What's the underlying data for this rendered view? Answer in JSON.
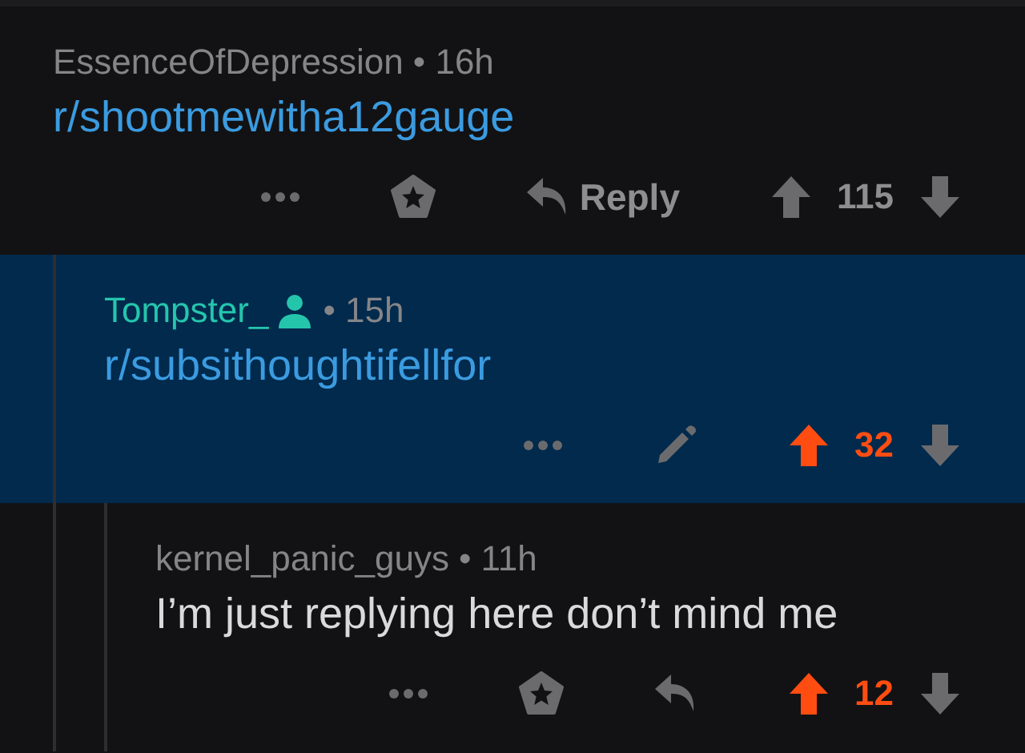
{
  "comments": [
    {
      "author": "EssenceOfDepression",
      "own": false,
      "time": "• 16h",
      "body": "r/shootmewitha12gauge",
      "link": true,
      "highlighted": false,
      "actions": [
        {
          "kind": "more"
        },
        {
          "kind": "award"
        },
        {
          "kind": "reply",
          "label": "Reply"
        }
      ],
      "score": "115",
      "upvoted": false,
      "children": [
        {
          "author": "Tompster_",
          "own": true,
          "time": "• 15h",
          "body": "r/subsithoughtifellfor",
          "link": true,
          "highlighted": true,
          "actions": [
            {
              "kind": "more"
            },
            {
              "kind": "edit"
            }
          ],
          "score": "32",
          "upvoted": true,
          "children": [
            {
              "author": "kernel_panic_guys",
              "own": false,
              "time": "• 11h",
              "body": "I’m just replying here don’t mind me",
              "link": false,
              "highlighted": false,
              "actions": [
                {
                  "kind": "more"
                },
                {
                  "kind": "award"
                },
                {
                  "kind": "reply"
                }
              ],
              "score": "12",
              "upvoted": true
            }
          ]
        }
      ]
    }
  ]
}
